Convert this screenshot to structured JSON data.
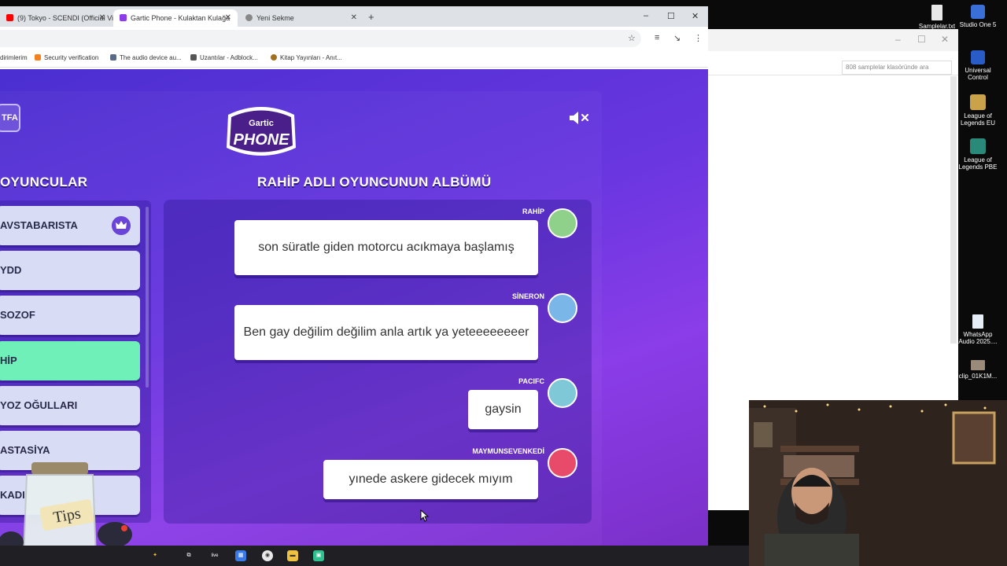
{
  "browser": {
    "tabs": [
      {
        "label": "(9) Tokyo - SCENDI (Official Vid",
        "active": false
      },
      {
        "label": "Gartic Phone - Kulaktan Kulağa",
        "active": true
      },
      {
        "label": "Yeni Sekme",
        "active": false
      }
    ],
    "new_tab_symbol": "+",
    "window_controls": {
      "minimize": "–",
      "maximize": "☐",
      "close": "✕"
    },
    "tab_close_symbol": "✕",
    "bookmarks": [
      {
        "label": "dirimlerim"
      },
      {
        "label": "Security verification"
      },
      {
        "label": "The audio device au..."
      },
      {
        "label": "Uzantılar - Adblock..."
      },
      {
        "label": "Kitap Yayınları - Anıt..."
      }
    ],
    "toolbar_icons": {
      "star": "☆",
      "cast": "≡",
      "extension": "↘",
      "menu": "⋮"
    }
  },
  "game": {
    "logo": {
      "line1": "Gartic",
      "line2": "PHONE"
    },
    "lang_button": "TFA",
    "mute_icon": "speaker-muted",
    "players_heading": "OYUNCULAR",
    "album_heading": "RAHİP ADLI OYUNCUNUN ALBÜMÜ",
    "players": [
      {
        "name": "AVSTABARISTA",
        "host": true,
        "highlight": false
      },
      {
        "name": "YDD",
        "host": false,
        "highlight": false
      },
      {
        "name": "SOZOF",
        "host": false,
        "highlight": false
      },
      {
        "name": "HİP",
        "host": false,
        "highlight": true
      },
      {
        "name": "YOZ OĞULLARI",
        "host": false,
        "highlight": false
      },
      {
        "name": "ASTASİYA",
        "host": false,
        "highlight": false
      },
      {
        "name": "KADI",
        "host": false,
        "highlight": false
      }
    ],
    "album": [
      {
        "author": "RAHİP",
        "text": "son süratle giden motorcu acıkmaya başlamış",
        "avatar_color": "#8fd18a"
      },
      {
        "author": "SİNERON",
        "text": "Ben gay değilim değilim anla artık ya yeteeeeeeeer",
        "avatar_color": "#7ab6e8"
      },
      {
        "author": "PACIFC",
        "text": "gaysin",
        "avatar_color": "#7ec8d8"
      },
      {
        "author": "MAYMUNSEVENKEDİ",
        "text": "yınede askere gidecek mıyım",
        "avatar_color": "#e84a6a"
      }
    ]
  },
  "overlay": {
    "tips_label": "Tips"
  },
  "explorer": {
    "search_placeholder": "808 samplelar klasöründe ara",
    "controls": {
      "minimize": "–",
      "maximize": "☐",
      "close": "✕"
    }
  },
  "desktop_icons": [
    {
      "label": "Samplelar.txt",
      "color": "#e8e8e8"
    },
    {
      "label": "Studio One 5",
      "color": "#3a6fd8"
    },
    {
      "label": "Universal Control",
      "color": "#2a5cc8"
    },
    {
      "label": "League of Legends EU",
      "color": "#c9a24a"
    },
    {
      "label": "League of Legends PBE",
      "color": "#2a8a7a"
    },
    {
      "label": "WhatsApp Audio 2025....",
      "color": "#e8eef8"
    },
    {
      "label": "clip_01K1M...",
      "color": "#9a8a7a"
    }
  ],
  "taskbar": {
    "items": [
      {
        "icon": "sparkle-icon",
        "color": "#f4c430",
        "label": "✦"
      },
      {
        "icon": "task-view-icon",
        "color": "#2a2a30",
        "label": "⧉"
      },
      {
        "icon": "live-icon",
        "color": "#2a2a30",
        "label": "live"
      },
      {
        "icon": "store-icon",
        "color": "#3a7ae8",
        "label": "▦"
      },
      {
        "icon": "chrome-icon",
        "color": "#e8e8e8",
        "label": "◉"
      },
      {
        "icon": "folder-icon",
        "color": "#f0c040",
        "label": "▬"
      },
      {
        "icon": "app-icon",
        "color": "#30c090",
        "label": "▣"
      }
    ]
  }
}
